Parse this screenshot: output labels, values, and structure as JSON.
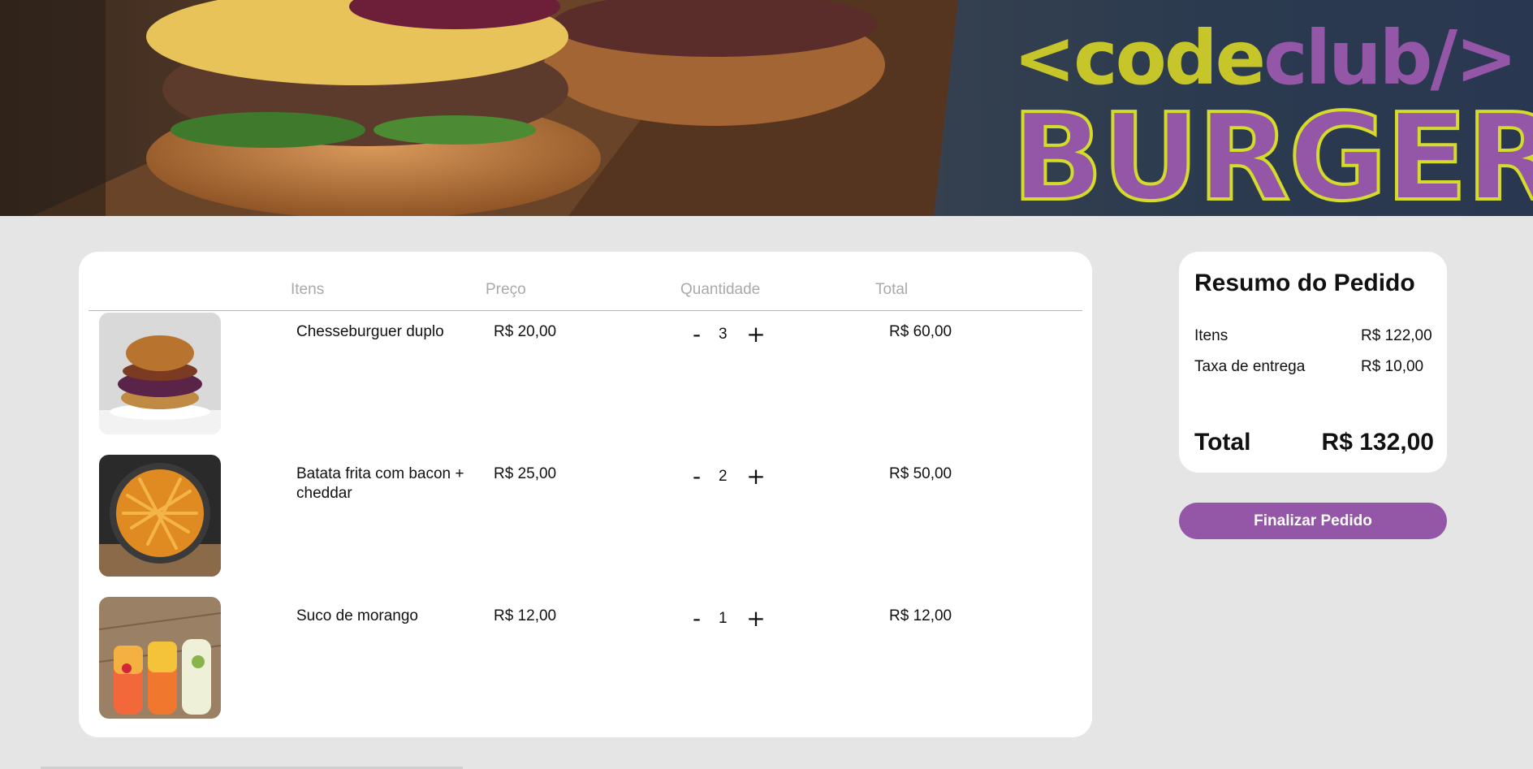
{
  "banner": {
    "logo_part1": "<code",
    "logo_part2": "club/>",
    "logo_word": "BURGER",
    "colors": {
      "green": "#c6c62a",
      "purple": "#9457a8"
    }
  },
  "cart": {
    "headers": {
      "items": "Itens",
      "price": "Preço",
      "quantity": "Quantidade",
      "total": "Total"
    },
    "items": [
      {
        "name": "Chesseburguer duplo",
        "price": "R$ 20,00",
        "quantity": "3",
        "total": "R$ 60,00",
        "image": "burger-image"
      },
      {
        "name": "Batata frita com bacon + cheddar",
        "price": "R$ 25,00",
        "quantity": "2",
        "total": "R$ 50,00",
        "image": "fries-image"
      },
      {
        "name": "Suco de morango",
        "price": "R$ 12,00",
        "quantity": "1",
        "total": "R$ 12,00",
        "image": "juice-image"
      }
    ],
    "minus_label": "-",
    "plus_label": "+"
  },
  "summary": {
    "title": "Resumo do Pedido",
    "items_label": "Itens",
    "items_value": "R$ 122,00",
    "delivery_label": "Taxa de entrega",
    "delivery_value": "R$ 10,00",
    "total_label": "Total",
    "total_value": "R$ 132,00"
  },
  "finish_button": "Finalizar Pedido",
  "accent_color": "#9457a8"
}
